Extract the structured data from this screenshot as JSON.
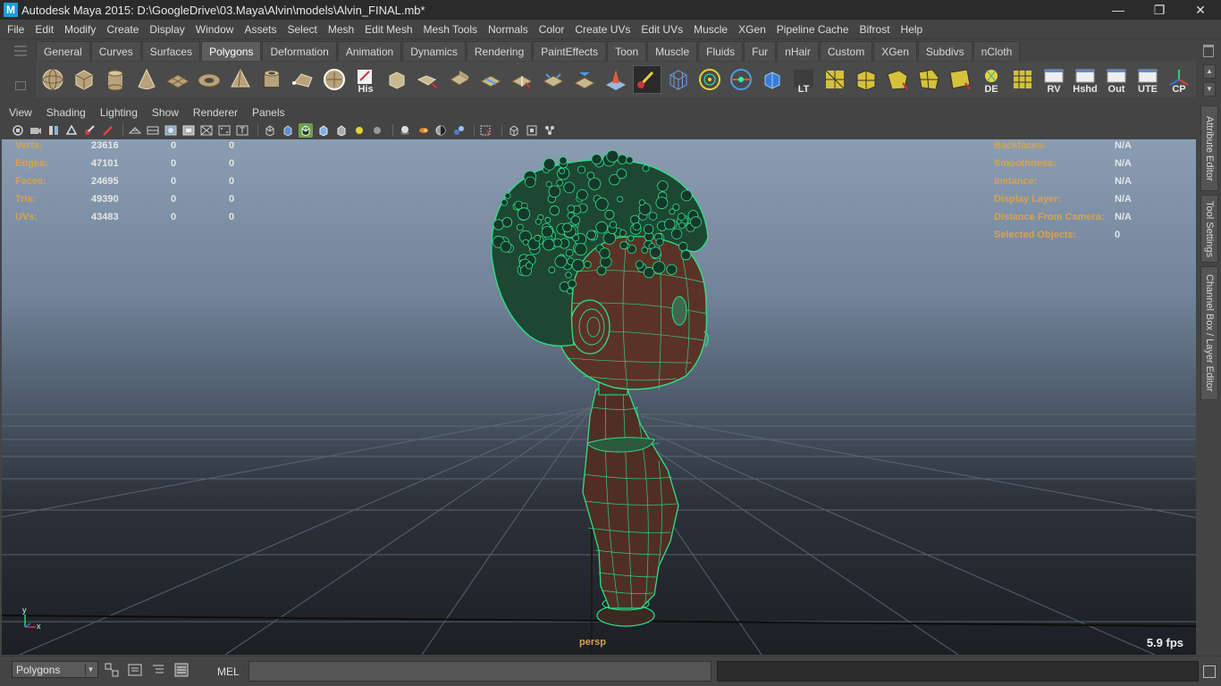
{
  "window": {
    "title": "Autodesk Maya 2015: D:\\GoogleDrive\\03.Maya\\Alvin\\models\\Alvin_FINAL.mb*",
    "logo_letter": "M",
    "minimize": "—",
    "restore": "❐",
    "close": "✕"
  },
  "menu": [
    "File",
    "Edit",
    "Modify",
    "Create",
    "Display",
    "Window",
    "Assets",
    "Select",
    "Mesh",
    "Edit Mesh",
    "Mesh Tools",
    "Normals",
    "Color",
    "Create UVs",
    "Edit UVs",
    "Muscle",
    "XGen",
    "Pipeline Cache",
    "Bifrost",
    "Help"
  ],
  "shelf": {
    "tabs": [
      "General",
      "Curves",
      "Surfaces",
      "Polygons",
      "Deformation",
      "Animation",
      "Dynamics",
      "Rendering",
      "PaintEffects",
      "Toon",
      "Muscle",
      "Fluids",
      "Fur",
      "nHair",
      "Custom",
      "XGen",
      "Subdivs",
      "nCloth"
    ],
    "active_tab": "Polygons",
    "icons": [
      {
        "name": "poly-sphere-icon",
        "label": ""
      },
      {
        "name": "poly-cube-icon",
        "label": ""
      },
      {
        "name": "poly-cylinder-icon",
        "label": ""
      },
      {
        "name": "poly-cone-icon",
        "label": ""
      },
      {
        "name": "poly-plane-icon",
        "label": ""
      },
      {
        "name": "poly-torus-icon",
        "label": ""
      },
      {
        "name": "poly-pyramid-icon",
        "label": ""
      },
      {
        "name": "poly-pipe-icon",
        "label": ""
      },
      {
        "name": "append-polygon-icon",
        "label": ""
      },
      {
        "name": "combine-icon",
        "label": ""
      },
      {
        "name": "history-icon",
        "label": "His"
      },
      {
        "name": "extrude-icon",
        "label": ""
      },
      {
        "name": "bridge-icon",
        "label": ""
      },
      {
        "name": "bevel-icon",
        "label": ""
      },
      {
        "name": "split-edge-icon",
        "label": ""
      },
      {
        "name": "insert-edge-loop-icon",
        "label": ""
      },
      {
        "name": "merge-icon",
        "label": ""
      },
      {
        "name": "collapse-icon",
        "label": ""
      },
      {
        "name": "poke-face-icon",
        "label": ""
      },
      {
        "name": "sculpt-brush-icon",
        "label": ""
      },
      {
        "name": "wireframe-box-icon",
        "label": ""
      },
      {
        "name": "target-weld-icon",
        "label": ""
      },
      {
        "name": "mirror-geometry-icon",
        "label": ""
      },
      {
        "name": "move-pivot-icon",
        "label": ""
      },
      {
        "name": "lt-icon",
        "label": "LT"
      },
      {
        "name": "uv-planar-icon",
        "label": ""
      },
      {
        "name": "uv-cylindrical-icon",
        "label": ""
      },
      {
        "name": "uv-spherical-icon",
        "label": ""
      },
      {
        "name": "uv-automatic-icon",
        "label": ""
      },
      {
        "name": "uv-layout-icon",
        "label": ""
      },
      {
        "name": "display-light-icon",
        "label": "DE"
      },
      {
        "name": "uv-grid-icon",
        "label": ""
      },
      {
        "name": "rv-icon",
        "label": "RV"
      },
      {
        "name": "hshd-icon",
        "label": "Hshd"
      },
      {
        "name": "out-icon",
        "label": "Out"
      },
      {
        "name": "ute-icon",
        "label": "UTE"
      },
      {
        "name": "cp-icon",
        "label": "CP"
      }
    ]
  },
  "panel": {
    "menu": [
      "View",
      "Shading",
      "Lighting",
      "Show",
      "Renderer",
      "Panels"
    ]
  },
  "hud": {
    "left": [
      {
        "label": "Verts:",
        "v1": "23616",
        "v2": "0",
        "v3": "0"
      },
      {
        "label": "Edges:",
        "v1": "47101",
        "v2": "0",
        "v3": "0"
      },
      {
        "label": "Faces:",
        "v1": "24695",
        "v2": "0",
        "v3": "0"
      },
      {
        "label": "Tris:",
        "v1": "49390",
        "v2": "0",
        "v3": "0"
      },
      {
        "label": "UVs:",
        "v1": "43483",
        "v2": "0",
        "v3": "0"
      }
    ],
    "right": [
      {
        "label": "Backfaces:",
        "value": "N/A"
      },
      {
        "label": "Smoothness:",
        "value": "N/A"
      },
      {
        "label": "Instance:",
        "value": "N/A"
      },
      {
        "label": "Display Layer:",
        "value": "N/A"
      },
      {
        "label": "Distance From Camera:",
        "value": "N/A"
      },
      {
        "label": "Selected Objects:",
        "value": "0"
      }
    ],
    "camera": "persp",
    "fps": "5.9 fps",
    "axis_y": "y",
    "axis_x": "x"
  },
  "dock_tabs": [
    "Attribute Editor",
    "Tool Settings",
    "Channel Box / Layer Editor"
  ],
  "bottom": {
    "mode": "Polygons",
    "command_lang": "MEL",
    "command_value": ""
  },
  "colors": {
    "hud_label": "#d9a34c",
    "wireframe": "#2fe08a",
    "skin": "#5a3326"
  }
}
